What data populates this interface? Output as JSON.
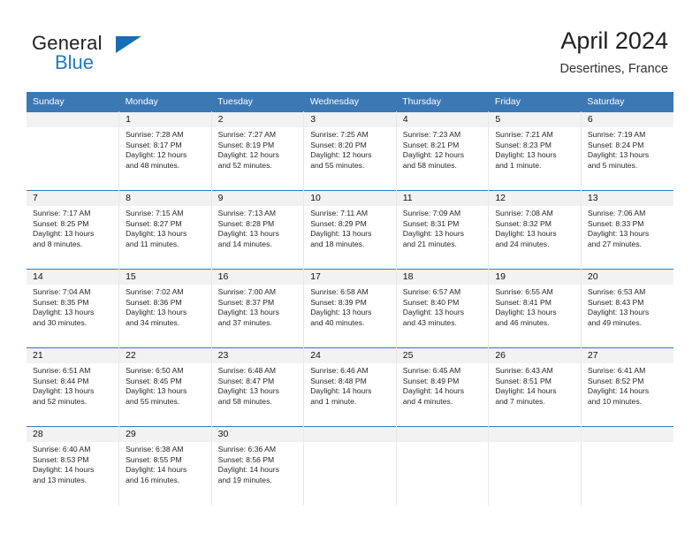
{
  "brand": {
    "name_top": "General",
    "name_bottom": "Blue",
    "accent_color": "#176db5",
    "logo_icon": "triangle-flag-icon"
  },
  "header": {
    "title": "April 2024",
    "subtitle": "Desertines, France"
  },
  "theme": {
    "header_bg": "#3c78b4",
    "header_text": "#ffffff",
    "daynum_band_bg": "#f2f2f2",
    "cell_border": "#3c78b4"
  },
  "calendar": {
    "weekday_headers": [
      "Sunday",
      "Monday",
      "Tuesday",
      "Wednesday",
      "Thursday",
      "Friday",
      "Saturday"
    ],
    "weeks": [
      [
        {
          "day": "",
          "sunrise": "",
          "sunset": "",
          "daylight_a": "",
          "daylight_b": "",
          "empty": true
        },
        {
          "day": "1",
          "sunrise": "Sunrise: 7:28 AM",
          "sunset": "Sunset: 8:17 PM",
          "daylight_a": "Daylight: 12 hours",
          "daylight_b": "and 48 minutes."
        },
        {
          "day": "2",
          "sunrise": "Sunrise: 7:27 AM",
          "sunset": "Sunset: 8:19 PM",
          "daylight_a": "Daylight: 12 hours",
          "daylight_b": "and 52 minutes."
        },
        {
          "day": "3",
          "sunrise": "Sunrise: 7:25 AM",
          "sunset": "Sunset: 8:20 PM",
          "daylight_a": "Daylight: 12 hours",
          "daylight_b": "and 55 minutes."
        },
        {
          "day": "4",
          "sunrise": "Sunrise: 7:23 AM",
          "sunset": "Sunset: 8:21 PM",
          "daylight_a": "Daylight: 12 hours",
          "daylight_b": "and 58 minutes."
        },
        {
          "day": "5",
          "sunrise": "Sunrise: 7:21 AM",
          "sunset": "Sunset: 8:23 PM",
          "daylight_a": "Daylight: 13 hours",
          "daylight_b": "and 1 minute."
        },
        {
          "day": "6",
          "sunrise": "Sunrise: 7:19 AM",
          "sunset": "Sunset: 8:24 PM",
          "daylight_a": "Daylight: 13 hours",
          "daylight_b": "and 5 minutes."
        }
      ],
      [
        {
          "day": "7",
          "sunrise": "Sunrise: 7:17 AM",
          "sunset": "Sunset: 8:25 PM",
          "daylight_a": "Daylight: 13 hours",
          "daylight_b": "and 8 minutes."
        },
        {
          "day": "8",
          "sunrise": "Sunrise: 7:15 AM",
          "sunset": "Sunset: 8:27 PM",
          "daylight_a": "Daylight: 13 hours",
          "daylight_b": "and 11 minutes."
        },
        {
          "day": "9",
          "sunrise": "Sunrise: 7:13 AM",
          "sunset": "Sunset: 8:28 PM",
          "daylight_a": "Daylight: 13 hours",
          "daylight_b": "and 14 minutes."
        },
        {
          "day": "10",
          "sunrise": "Sunrise: 7:11 AM",
          "sunset": "Sunset: 8:29 PM",
          "daylight_a": "Daylight: 13 hours",
          "daylight_b": "and 18 minutes."
        },
        {
          "day": "11",
          "sunrise": "Sunrise: 7:09 AM",
          "sunset": "Sunset: 8:31 PM",
          "daylight_a": "Daylight: 13 hours",
          "daylight_b": "and 21 minutes."
        },
        {
          "day": "12",
          "sunrise": "Sunrise: 7:08 AM",
          "sunset": "Sunset: 8:32 PM",
          "daylight_a": "Daylight: 13 hours",
          "daylight_b": "and 24 minutes."
        },
        {
          "day": "13",
          "sunrise": "Sunrise: 7:06 AM",
          "sunset": "Sunset: 8:33 PM",
          "daylight_a": "Daylight: 13 hours",
          "daylight_b": "and 27 minutes."
        }
      ],
      [
        {
          "day": "14",
          "sunrise": "Sunrise: 7:04 AM",
          "sunset": "Sunset: 8:35 PM",
          "daylight_a": "Daylight: 13 hours",
          "daylight_b": "and 30 minutes."
        },
        {
          "day": "15",
          "sunrise": "Sunrise: 7:02 AM",
          "sunset": "Sunset: 8:36 PM",
          "daylight_a": "Daylight: 13 hours",
          "daylight_b": "and 34 minutes."
        },
        {
          "day": "16",
          "sunrise": "Sunrise: 7:00 AM",
          "sunset": "Sunset: 8:37 PM",
          "daylight_a": "Daylight: 13 hours",
          "daylight_b": "and 37 minutes."
        },
        {
          "day": "17",
          "sunrise": "Sunrise: 6:58 AM",
          "sunset": "Sunset: 8:39 PM",
          "daylight_a": "Daylight: 13 hours",
          "daylight_b": "and 40 minutes."
        },
        {
          "day": "18",
          "sunrise": "Sunrise: 6:57 AM",
          "sunset": "Sunset: 8:40 PM",
          "daylight_a": "Daylight: 13 hours",
          "daylight_b": "and 43 minutes."
        },
        {
          "day": "19",
          "sunrise": "Sunrise: 6:55 AM",
          "sunset": "Sunset: 8:41 PM",
          "daylight_a": "Daylight: 13 hours",
          "daylight_b": "and 46 minutes."
        },
        {
          "day": "20",
          "sunrise": "Sunrise: 6:53 AM",
          "sunset": "Sunset: 8:43 PM",
          "daylight_a": "Daylight: 13 hours",
          "daylight_b": "and 49 minutes."
        }
      ],
      [
        {
          "day": "21",
          "sunrise": "Sunrise: 6:51 AM",
          "sunset": "Sunset: 8:44 PM",
          "daylight_a": "Daylight: 13 hours",
          "daylight_b": "and 52 minutes."
        },
        {
          "day": "22",
          "sunrise": "Sunrise: 6:50 AM",
          "sunset": "Sunset: 8:45 PM",
          "daylight_a": "Daylight: 13 hours",
          "daylight_b": "and 55 minutes."
        },
        {
          "day": "23",
          "sunrise": "Sunrise: 6:48 AM",
          "sunset": "Sunset: 8:47 PM",
          "daylight_a": "Daylight: 13 hours",
          "daylight_b": "and 58 minutes."
        },
        {
          "day": "24",
          "sunrise": "Sunrise: 6:46 AM",
          "sunset": "Sunset: 8:48 PM",
          "daylight_a": "Daylight: 14 hours",
          "daylight_b": "and 1 minute."
        },
        {
          "day": "25",
          "sunrise": "Sunrise: 6:45 AM",
          "sunset": "Sunset: 8:49 PM",
          "daylight_a": "Daylight: 14 hours",
          "daylight_b": "and 4 minutes."
        },
        {
          "day": "26",
          "sunrise": "Sunrise: 6:43 AM",
          "sunset": "Sunset: 8:51 PM",
          "daylight_a": "Daylight: 14 hours",
          "daylight_b": "and 7 minutes."
        },
        {
          "day": "27",
          "sunrise": "Sunrise: 6:41 AM",
          "sunset": "Sunset: 8:52 PM",
          "daylight_a": "Daylight: 14 hours",
          "daylight_b": "and 10 minutes."
        }
      ],
      [
        {
          "day": "28",
          "sunrise": "Sunrise: 6:40 AM",
          "sunset": "Sunset: 8:53 PM",
          "daylight_a": "Daylight: 14 hours",
          "daylight_b": "and 13 minutes."
        },
        {
          "day": "29",
          "sunrise": "Sunrise: 6:38 AM",
          "sunset": "Sunset: 8:55 PM",
          "daylight_a": "Daylight: 14 hours",
          "daylight_b": "and 16 minutes."
        },
        {
          "day": "30",
          "sunrise": "Sunrise: 6:36 AM",
          "sunset": "Sunset: 8:56 PM",
          "daylight_a": "Daylight: 14 hours",
          "daylight_b": "and 19 minutes."
        },
        {
          "day": "",
          "sunrise": "",
          "sunset": "",
          "daylight_a": "",
          "daylight_b": "",
          "empty": true
        },
        {
          "day": "",
          "sunrise": "",
          "sunset": "",
          "daylight_a": "",
          "daylight_b": "",
          "empty": true
        },
        {
          "day": "",
          "sunrise": "",
          "sunset": "",
          "daylight_a": "",
          "daylight_b": "",
          "empty": true
        },
        {
          "day": "",
          "sunrise": "",
          "sunset": "",
          "daylight_a": "",
          "daylight_b": "",
          "empty": true
        }
      ]
    ]
  }
}
